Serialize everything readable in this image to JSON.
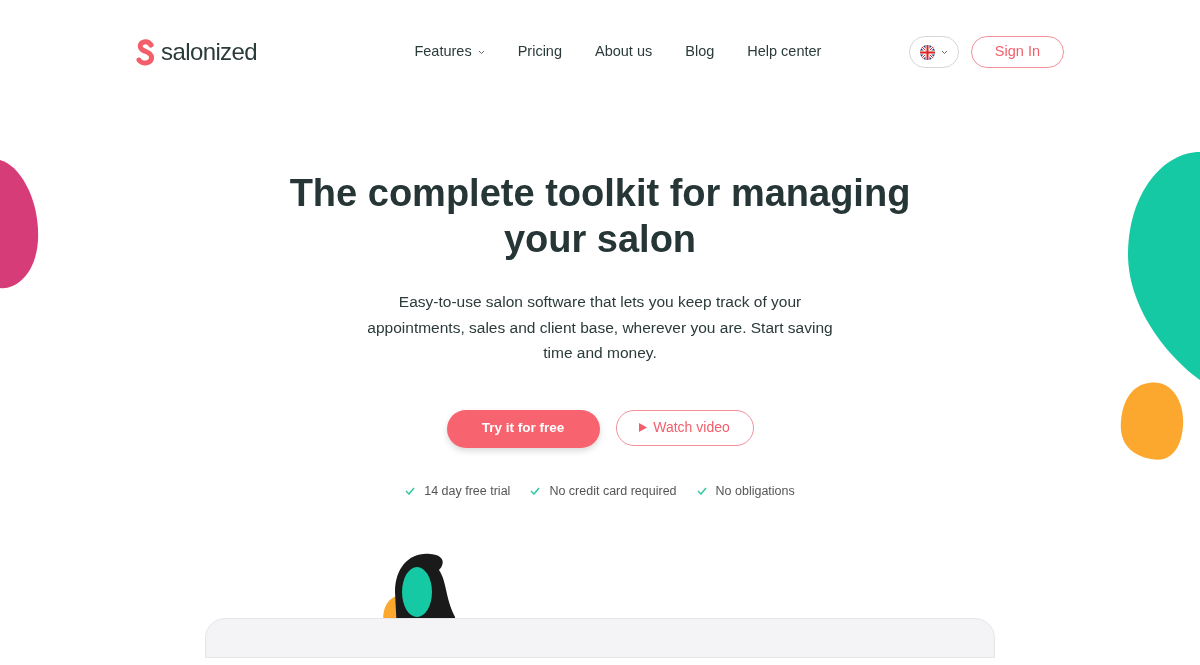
{
  "logo": {
    "text": "salonized"
  },
  "nav": [
    {
      "label": "Features",
      "kind": "dropdown"
    },
    {
      "label": "Pricing",
      "kind": "link"
    },
    {
      "label": "About us",
      "kind": "link"
    },
    {
      "label": "Blog",
      "kind": "link"
    },
    {
      "label": "Help center",
      "kind": "link"
    }
  ],
  "sign_in": "Sign In",
  "hero": {
    "title": "The complete toolkit for managing your salon",
    "subtitle": "Easy-to-use salon software that lets you keep track of your appointments, sales and client base, wherever you are. Start saving time and money.",
    "primary_button": "Try it for free",
    "secondary_button": "Watch video",
    "perks": [
      "14 day free trial",
      "No credit card required",
      "No obligations"
    ]
  }
}
